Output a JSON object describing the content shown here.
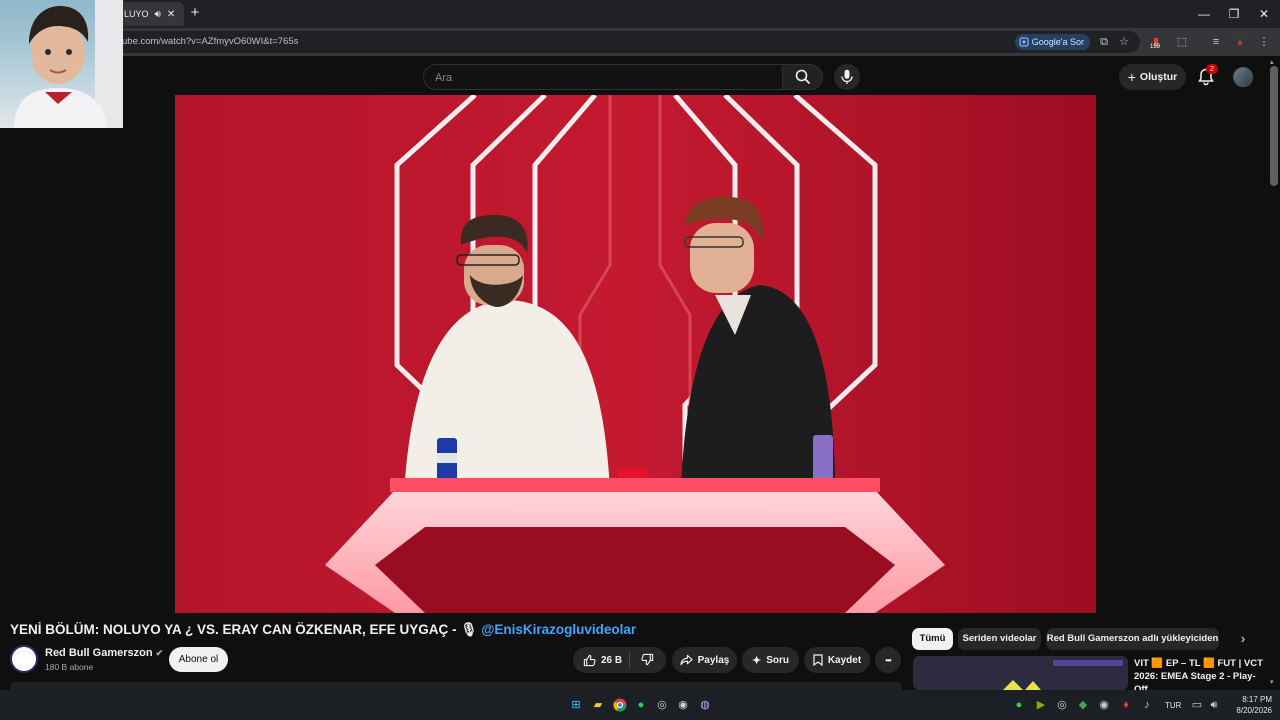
{
  "browser": {
    "tab_title": "LUYO",
    "url": "ube.com/watch?v=AZfmyvO60WI&t=765s",
    "google_ask_label": "Google'a Sor",
    "extension_badge": "159"
  },
  "header": {
    "search_placeholder": "Ara",
    "create_label": "Oluştur",
    "notification_count": "2"
  },
  "video": {
    "title_main": "YENİ BÖLÜM: NOLUYO YA ¿ VS. ERAY CAN ÖZKENAR, EFE UYGAÇ -",
    "title_emoji": "🎙",
    "title_mention": "@EnisKirazogluvideolar",
    "channel_name": "Red Bull Gamerszon",
    "subscribers": "180 B abone",
    "subscribe_label": "Abone ol",
    "like_count": "26 B",
    "share_label": "Paylaş",
    "ask_label": "Soru",
    "save_label": "Kaydet",
    "more_label": "•••"
  },
  "sidebar": {
    "chips": [
      "Tümü",
      "Seriden videolar",
      "Red Bull Gamerszon adlı yükleyiciden"
    ],
    "rec_title": "VIT 🟧 EP – TL 🟧 FUT | VCT 2026: EMEA Stage 2 - Play-Off..."
  },
  "taskbar": {
    "language": "TUR",
    "time": "8:17 PM",
    "date": "8/20/2026"
  },
  "colors": {
    "youtube_bg": "#0f0f0f",
    "link_blue": "#3ea6ff",
    "video_red": "#a50e22",
    "notification_red": "#cc0000"
  }
}
